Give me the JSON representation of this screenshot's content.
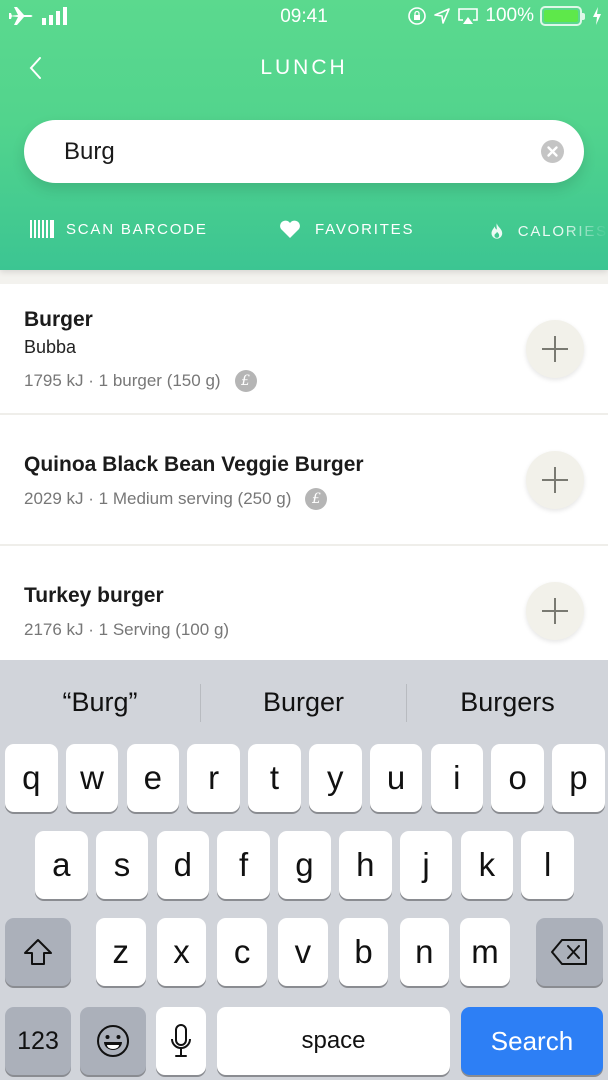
{
  "status_bar": {
    "time": "09:41",
    "battery": "100%",
    "icons": [
      "airplane-icon",
      "signal-icon",
      "orientation-lock-icon",
      "location-icon",
      "airplay-icon",
      "battery-icon",
      "charging-icon"
    ]
  },
  "header": {
    "title": "LUNCH",
    "back_icon": "chevron-left-icon"
  },
  "search": {
    "value": "Burg",
    "clear_icon": "clear-icon"
  },
  "tabs": [
    {
      "label": "SCAN BARCODE",
      "icon": "barcode-icon"
    },
    {
      "label": "FAVORITES",
      "icon": "heart-icon"
    },
    {
      "label": "CALORIES",
      "icon": "flame-icon"
    }
  ],
  "results": [
    {
      "name": "Burger",
      "brand": "Bubba",
      "meta": "1795 kJ · 1 burger (150 g)",
      "verified": true
    },
    {
      "name": "Quinoa Black Bean Veggie Burger",
      "brand": "",
      "meta": "2029 kJ · 1 Medium serving (250 g)",
      "verified": true
    },
    {
      "name": "Turkey burger",
      "brand": "",
      "meta": "2176 kJ · 1 Serving (100 g)",
      "verified": false
    }
  ],
  "badge_glyph": "£",
  "keyboard": {
    "suggestions": [
      "“Burg”",
      "Burger",
      "Burgers"
    ],
    "row1": [
      "q",
      "w",
      "e",
      "r",
      "t",
      "y",
      "u",
      "i",
      "o",
      "p"
    ],
    "row2": [
      "a",
      "s",
      "d",
      "f",
      "g",
      "h",
      "j",
      "k",
      "l"
    ],
    "row3": [
      "z",
      "x",
      "c",
      "v",
      "b",
      "n",
      "m"
    ],
    "numbers_label": "123",
    "space_label": "space",
    "search_label": "Search"
  },
  "colors": {
    "header_green": "#52d48d",
    "search_key_blue": "#2d7ff5",
    "cursor_green": "#3ecf8e"
  }
}
